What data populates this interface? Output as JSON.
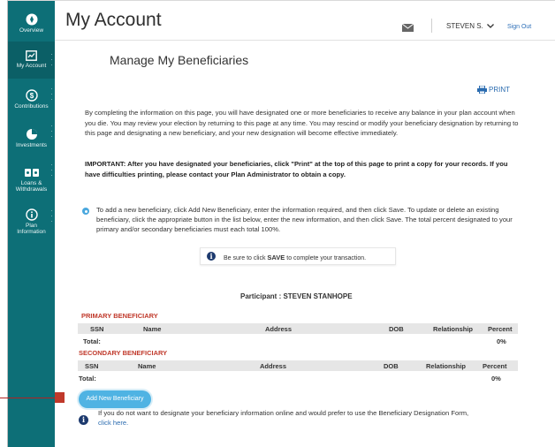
{
  "sidebar": {
    "items": [
      {
        "label": "Overview",
        "icon": "compass-icon"
      },
      {
        "label": "My Account",
        "icon": "chart-icon"
      },
      {
        "label": "Contributions",
        "icon": "dollar-icon"
      },
      {
        "label": "Investments",
        "icon": "pie-icon"
      },
      {
        "label": "Loans &",
        "label2": "Withdrawals",
        "icon": "money-icon"
      },
      {
        "label": "Plan",
        "label2": "Information",
        "icon": "info-icon"
      }
    ],
    "color": "#0d6f77"
  },
  "header": {
    "title": "My Account",
    "user": "STEVEN S.",
    "sign_out": "Sign Out"
  },
  "page": {
    "subtitle": "Manage My Beneficiaries",
    "print": "PRINT",
    "intro": "By completing the information on this page, you will have designated one or more beneficiaries to receive any balance in your plan account when you die. You may review your election by returning to this page at any time. You may rescind or modify your beneficiary designation by returning to this page and designating a new beneficiary, and your new designation will become effective immediately.",
    "important": "IMPORTANT: After you have designated your beneficiaries, click \"Print\" at the top of this page to print a copy for your records. If you have difficulties printing, please contact your Plan Administrator to obtain a copy.",
    "instructions": "To add a new beneficiary, click Add New Beneficiary, enter the information required, and then click Save. To update or delete an existing beneficiary, click the appropriate button in the list below, enter the new information, and then click Save. The total percent designated to your primary and/or secondary beneficiaries must each total 100%.",
    "notice_pre": "Be sure to click",
    "notice_bold": "SAVE",
    "notice_post": "to complete your transaction.",
    "participant": "Participant : STEVEN STANHOPE",
    "primary_label": "PRIMARY BENEFICIARY",
    "secondary_label": "SECONDARY BENEFICIARY",
    "columns": [
      "SSN",
      "Name",
      "Address",
      "DOB",
      "Relationship",
      "Percent"
    ],
    "total_label": "Total:",
    "primary_total": "0%",
    "secondary_total": "0%",
    "add_button": "Add New Beneficiary",
    "footer": "If you do not want to designate your beneficiary information online and would prefer to use the Beneficiary Designation Form,",
    "footer_link": "click here."
  }
}
